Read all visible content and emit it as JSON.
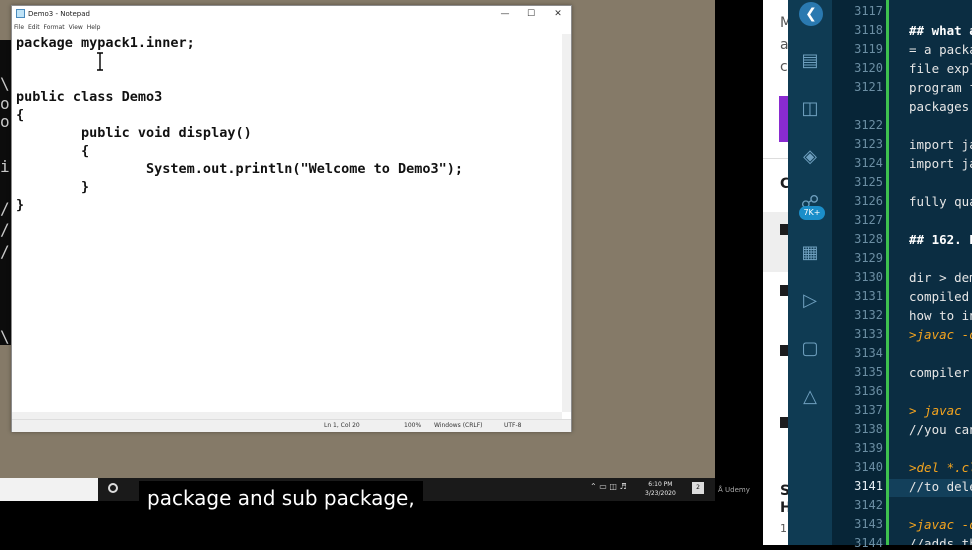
{
  "notepad": {
    "title": "Demo3 - Notepad",
    "menu": [
      "File",
      "Edit",
      "Format",
      "View",
      "Help"
    ],
    "code_lines": [
      "package mypack1.inner;",
      "",
      "",
      "public class Demo3",
      "{",
      "        public void display()",
      "        {",
      "                System.out.println(\"Welcome to Demo3\");",
      "        }",
      "}"
    ],
    "status": {
      "position": "Ln 1, Col 20",
      "zoom": "100%",
      "line_ending": "Windows (CRLF)",
      "encoding": "UTF-8"
    }
  },
  "cmd_fragments": [
    "\\",
    "o",
    "o",
    "i",
    "/",
    "/",
    "/",
    "\\"
  ],
  "taskbar": {
    "time": "6:10 PM",
    "date": "3/23/2020",
    "udemy": "Udemy",
    "notification_count": "2"
  },
  "caption": "package and sub package,",
  "browser_fragments": [
    {
      "text": "M",
      "key": "m"
    },
    {
      "text": "a",
      "key": "a"
    },
    {
      "text": "c",
      "key": "c"
    },
    {
      "text": "C",
      "key": "c2"
    },
    {
      "text": "S",
      "key": "s"
    },
    {
      "text": "H",
      "key": "h"
    },
    {
      "text": "1",
      "key": "one"
    }
  ],
  "vscode": {
    "badge": "7K+",
    "current_line": "3141",
    "lines": [
      {
        "n": "3117",
        "text": ""
      },
      {
        "n": "3118",
        "text": "## what a"
      },
      {
        "n": "3119",
        "text": "= a packa"
      },
      {
        "n": "3120",
        "text": "file expl"
      },
      {
        "n": "3121",
        "text": "program f"
      },
      {
        "n": "",
        "text": "packages"
      },
      {
        "n": "3122",
        "text": ""
      },
      {
        "n": "3123",
        "text": "import ja"
      },
      {
        "n": "3124",
        "text": "import ja"
      },
      {
        "n": "3125",
        "text": ""
      },
      {
        "n": "3126",
        "text": "fully qua"
      },
      {
        "n": "3127",
        "text": ""
      },
      {
        "n": "3128",
        "text": "## 162. P"
      },
      {
        "n": "3129",
        "text": ""
      },
      {
        "n": "3130",
        "text": "dir > dem"
      },
      {
        "n": "3131",
        "text": "compiled"
      },
      {
        "n": "3132",
        "text": "how to in"
      },
      {
        "n": "3133",
        "text": ">javac -d"
      },
      {
        "n": "3134",
        "text": ""
      },
      {
        "n": "3135",
        "text": "compiler"
      },
      {
        "n": "3136",
        "text": ""
      },
      {
        "n": "3137",
        "text": "> javac"
      },
      {
        "n": "3138",
        "text": "//you can"
      },
      {
        "n": "3139",
        "text": ""
      },
      {
        "n": "3140",
        "text": ">del *.cl"
      },
      {
        "n": "3141",
        "text": "//to dele"
      },
      {
        "n": "3142",
        "text": ""
      },
      {
        "n": "3143",
        "text": ">javac -d"
      },
      {
        "n": "3144",
        "text": "//adds th"
      }
    ]
  }
}
